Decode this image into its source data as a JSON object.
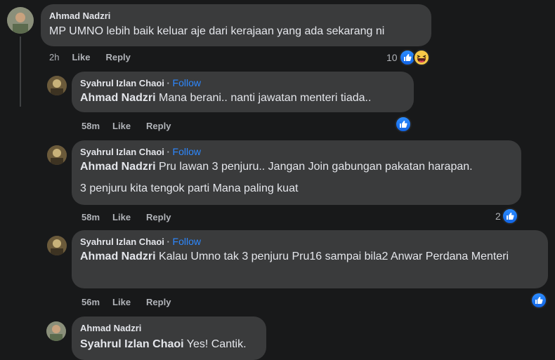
{
  "comment1": {
    "author": "Ahmad Nadzri",
    "text": "MP UMNO lebih baik keluar aje dari kerajaan yang ada sekarang ni",
    "time": "2h",
    "like": "Like",
    "reply": "Reply",
    "reaction_count": "10",
    "reactions": [
      "like-icon",
      "haha-icon"
    ]
  },
  "replies": [
    {
      "author": "Syahrul Izlan Chaoi",
      "dot": "·",
      "follow": "Follow",
      "mention": "Ahmad Nadzri",
      "text": "Mana berani.. nanti jawatan menteri tiada..",
      "time": "58m",
      "like": "Like",
      "reply": "Reply"
    },
    {
      "author": "Syahrul Izlan Chaoi",
      "dot": "·",
      "follow": "Follow",
      "mention": "Ahmad Nadzri",
      "text": "Pru lawan 3 penjuru.. Jangan Join gabungan pakatan harapan.",
      "text2": "3 penjuru kita tengok parti Mana paling kuat",
      "time": "58m",
      "like": "Like",
      "reply": "Reply",
      "reaction_count": "2"
    },
    {
      "author": "Syahrul Izlan Chaoi",
      "dot": "·",
      "follow": "Follow",
      "mention": "Ahmad Nadzri",
      "text": "Kalau Umno tak 3 penjuru Pru16 sampai bila2 Anwar Perdana Menteri",
      "time": "56m",
      "like": "Like",
      "reply": "Reply"
    },
    {
      "author": "Ahmad Nadzri",
      "mention": "Syahrul Izlan Chaoi",
      "text": "Yes! Cantik."
    }
  ]
}
